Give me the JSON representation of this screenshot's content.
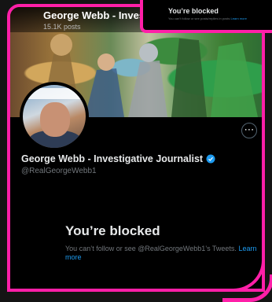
{
  "header": {
    "title": "George Webb - Investi",
    "posts": "15.1K posts"
  },
  "profile": {
    "name": "George Webb - Investigative Journalist",
    "handle": "@RealGeorgeWebb1",
    "more_icon": "more-horizontal-icon",
    "verified_icon": "verified-badge-icon"
  },
  "blocked": {
    "title": "You’re blocked",
    "text": "You can’t follow or see @RealGeorgeWebb1’s Tweets.",
    "link": "Learn more"
  },
  "mini": {
    "title": "You’re blocked",
    "text": "You can’t follow or see posts/replies in posts",
    "link": "Learn more"
  },
  "colors": {
    "accent_border": "#ff1fa8",
    "link": "#1d9bf0",
    "verified": "#1d9bf0"
  }
}
